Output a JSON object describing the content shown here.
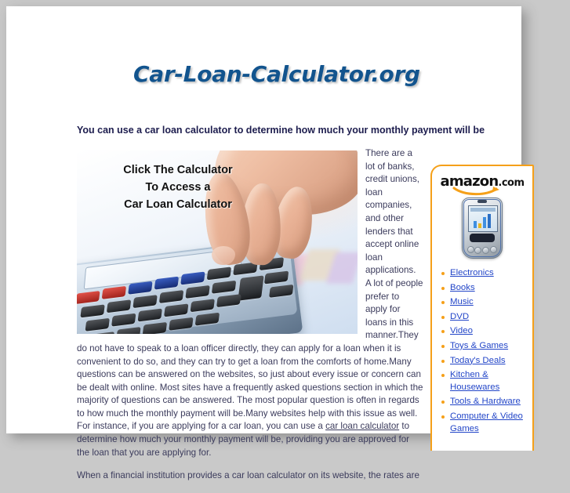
{
  "site": {
    "title": "Car-Loan-Calculator.org"
  },
  "headline": "You can use a car loan calculator to determine how much your monthly payment will be",
  "article": {
    "paragraph_1_part_1": "There are a lot of banks, credit unions, loan companies, and other lenders that accept online loan applications. A lot of people prefer to apply for loans in this manner.They do not have to speak to a loan officer directly, they can apply for a loan when it is convenient to do so, and they can try to get a loan from the comforts of home.Many questions can be answered on the websites, so just about every issue or concern can be dealt with online. Most sites have a frequently asked questions section in which the majority of questions can be answered. The most popular question is often in regards to how much the monthly payment will be.Many websites help with this issue as well. For instance, if you are applying for a car loan, you can use a ",
    "paragraph_1_link": "car loan calculator",
    "paragraph_1_part_2": " to determine how much your monthly payment will be, providing you are approved for the loan that you are applying for.",
    "paragraph_2": "When a financial institution provides a car loan calculator on its website, the rates are"
  },
  "calc_photo": {
    "overlay_line_1": "Click The Calculator",
    "overlay_line_2": "To Access a",
    "overlay_line_3": "Car Loan Calculator",
    "alt": "finger pressing keys on a desktop calculator"
  },
  "sidebar": {
    "logo_word": "amazon",
    "logo_suffix": ".com",
    "device_alt": "amazon handheld PDA device",
    "links": [
      {
        "label": "Electronics"
      },
      {
        "label": "Books"
      },
      {
        "label": "Music"
      },
      {
        "label": "DVD"
      },
      {
        "label": "Video"
      },
      {
        "label": "Toys & Games"
      },
      {
        "label": "Today's Deals"
      },
      {
        "label": "Kitchen & Housewares"
      },
      {
        "label": "Tools & Hardware"
      },
      {
        "label": "Computer & Video Games"
      }
    ]
  },
  "colors": {
    "title_blue": "#12548e",
    "headline_navy": "#1d1d4e",
    "body_text": "#3b3b5c",
    "amazon_orange": "#f5a019",
    "link_blue": "#2346c8",
    "page_background": "#c9c9c9"
  }
}
